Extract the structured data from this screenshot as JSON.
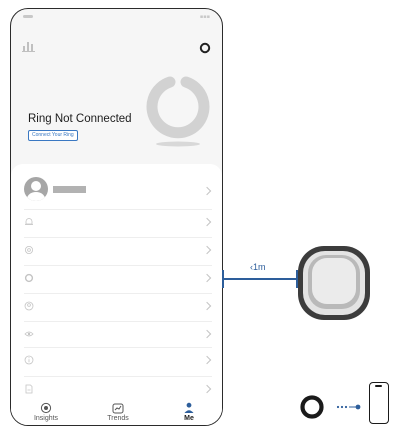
{
  "screen": {
    "ring_status_title": "Ring Not Connected",
    "connect_button_label": "Connect Your Ring"
  },
  "menu": {
    "profile_chevron": "chevron-right-icon",
    "items": [
      {
        "icon": "bell-icon"
      },
      {
        "icon": "settings-icon"
      },
      {
        "icon": "ring-icon"
      },
      {
        "icon": "user-circle-icon"
      },
      {
        "icon": "eye-icon"
      },
      {
        "icon": "info-icon"
      },
      {
        "icon": "document-icon"
      }
    ]
  },
  "tab_bar": {
    "tabs": [
      {
        "label": "Insights",
        "icon": "target-icon",
        "active": false
      },
      {
        "label": "Trends",
        "icon": "trend-icon",
        "active": false
      },
      {
        "label": "Me",
        "icon": "person-icon",
        "active": true
      }
    ]
  },
  "distance": {
    "label": "‹1m"
  },
  "colors": {
    "accent": "#2d5e9b",
    "button_border": "#3a78c2",
    "inactive_gray": "#a6a6a6"
  }
}
